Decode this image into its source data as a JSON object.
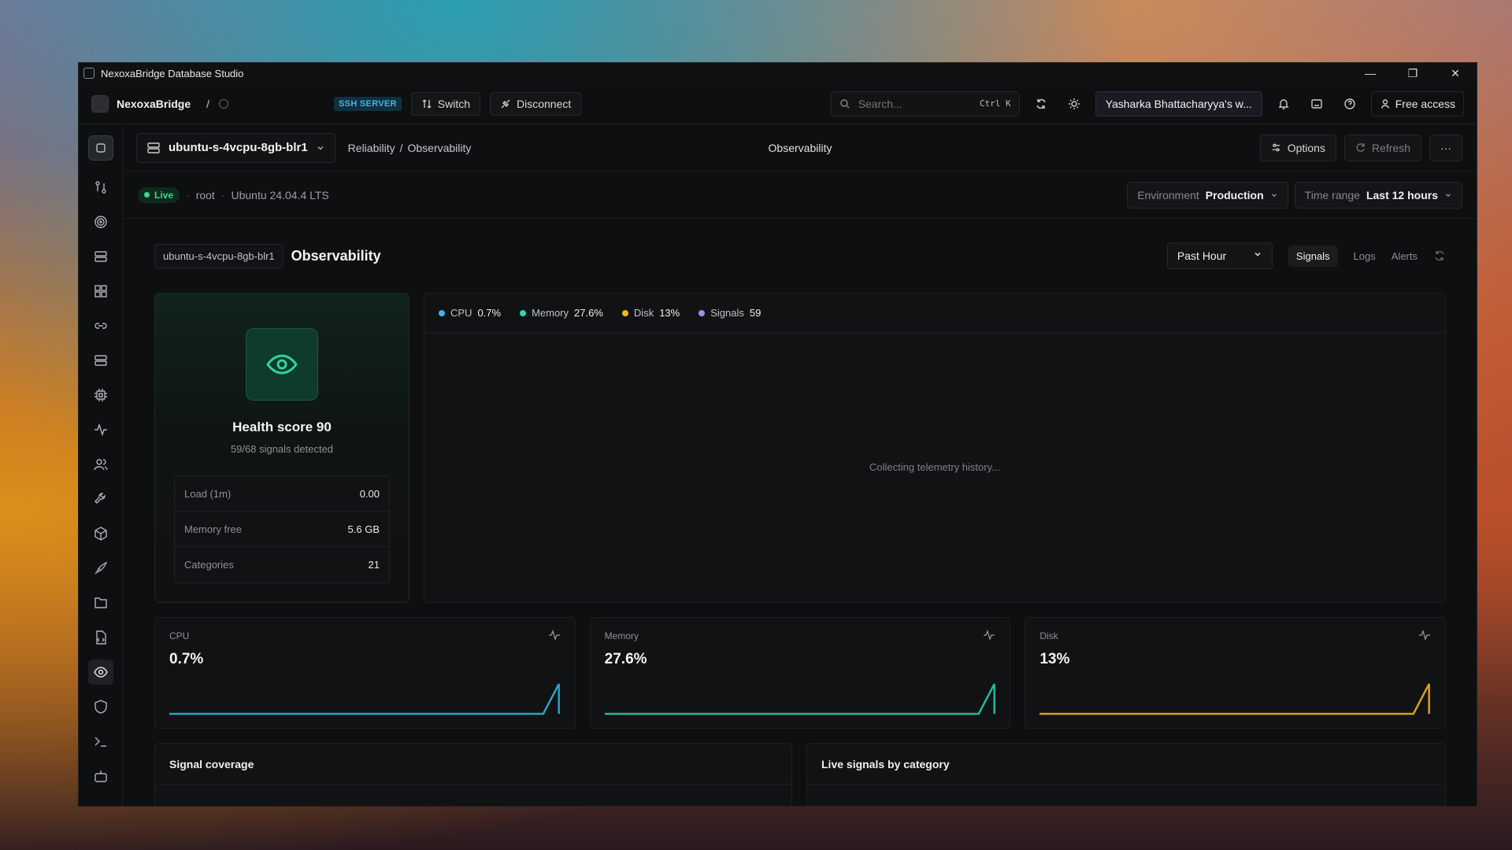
{
  "window": {
    "title": "NexoxaBridge Database Studio"
  },
  "topbar": {
    "brand": "NexoxaBridge",
    "slash": "/",
    "ssh_badge": "SSH SERVER",
    "switch_label": "Switch",
    "disconnect_label": "Disconnect",
    "search_placeholder": "Search...",
    "search_shortcut": "Ctrl K",
    "workspace": "Yasharka Bhattacharyya's w...",
    "free_access": "Free access"
  },
  "header": {
    "server": "ubuntu-s-4vcpu-8gb-blr1",
    "breadcrumb": [
      "Reliability",
      "/",
      "Observability"
    ],
    "page_title": "Observability",
    "options_label": "Options",
    "refresh_label": "Refresh",
    "more_label": "···"
  },
  "status": {
    "live": "Live",
    "user": "root",
    "os": "Ubuntu 24.04.4 LTS",
    "environment_key": "Environment",
    "environment_value": "Production",
    "time_range_key": "Time range",
    "time_range_value": "Last 12 hours"
  },
  "observability": {
    "chip": "ubuntu-s-4vcpu-8gb-blr1",
    "title": "Observability",
    "period": "Past Hour",
    "tabs": [
      "Signals",
      "Logs",
      "Alerts"
    ],
    "active_tab": "Signals"
  },
  "health": {
    "title": "Health score 90",
    "subtitle": "59/68 signals detected",
    "metrics": [
      {
        "label": "Load (1m)",
        "value": "0.00"
      },
      {
        "label": "Memory free",
        "value": "5.6 GB"
      },
      {
        "label": "Categories",
        "value": "21"
      }
    ]
  },
  "telemetry": {
    "legend": [
      {
        "name": "CPU",
        "value": "0.7%",
        "color": "#3fb6e8"
      },
      {
        "name": "Memory",
        "value": "27.6%",
        "color": "#2fd3b6"
      },
      {
        "name": "Disk",
        "value": "13%",
        "color": "#f0b42a"
      },
      {
        "name": "Signals",
        "value": "59",
        "color": "#9d8ff0"
      }
    ],
    "placeholder": "Collecting telemetry history..."
  },
  "cards": [
    {
      "label": "CPU",
      "value": "0.7%",
      "color": "#2aa3c8"
    },
    {
      "label": "Memory",
      "value": "27.6%",
      "color": "#25b8a2"
    },
    {
      "label": "Disk",
      "value": "13%",
      "color": "#d9a021"
    }
  ],
  "panels": {
    "coverage_title": "Signal coverage",
    "live_title": "Live signals by category",
    "bar_color": "#7c6cf0"
  }
}
